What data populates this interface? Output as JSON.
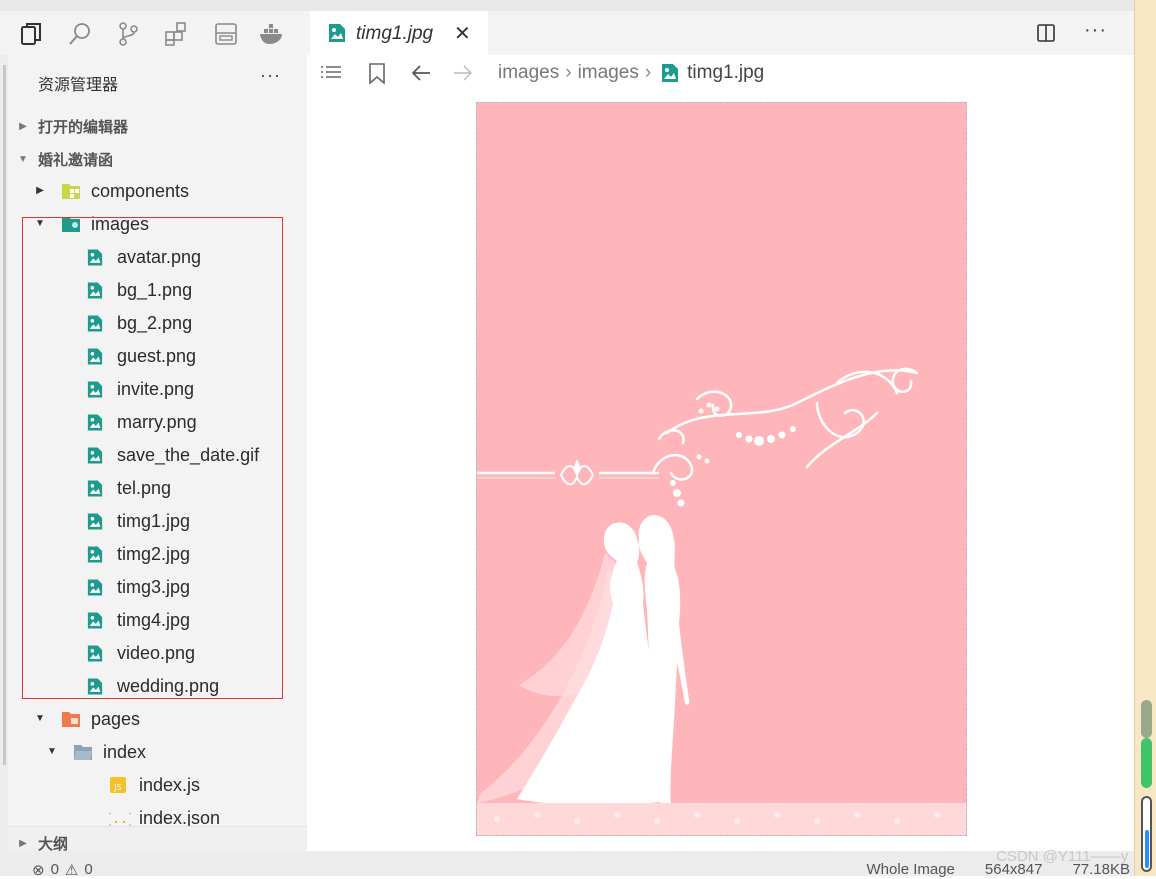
{
  "activity_bar": {
    "icons": [
      "explorer-icon",
      "search-icon",
      "source-control-icon",
      "extensions-icon",
      "panel-icon",
      "docker-icon"
    ]
  },
  "sidebar": {
    "title": "资源管理器",
    "more": "···",
    "open_editors": "打开的编辑器",
    "project": "婚礼邀请函",
    "tree": [
      {
        "label": "components",
        "kind": "folder-components",
        "depth": 0,
        "expanded": false
      },
      {
        "label": "images",
        "kind": "folder-images",
        "depth": 0,
        "expanded": true
      },
      {
        "label": "avatar.png",
        "kind": "image",
        "depth": 1
      },
      {
        "label": "bg_1.png",
        "kind": "image",
        "depth": 1
      },
      {
        "label": "bg_2.png",
        "kind": "image",
        "depth": 1
      },
      {
        "label": "guest.png",
        "kind": "image",
        "depth": 1
      },
      {
        "label": "invite.png",
        "kind": "image",
        "depth": 1
      },
      {
        "label": "marry.png",
        "kind": "image",
        "depth": 1
      },
      {
        "label": "save_the_date.gif",
        "kind": "image",
        "depth": 1
      },
      {
        "label": "tel.png",
        "kind": "image",
        "depth": 1
      },
      {
        "label": "timg1.jpg",
        "kind": "image",
        "depth": 1
      },
      {
        "label": "timg2.jpg",
        "kind": "image",
        "depth": 1
      },
      {
        "label": "timg3.jpg",
        "kind": "image",
        "depth": 1
      },
      {
        "label": "timg4.jpg",
        "kind": "image",
        "depth": 1
      },
      {
        "label": "video.png",
        "kind": "image",
        "depth": 1
      },
      {
        "label": "wedding.png",
        "kind": "image",
        "depth": 1
      },
      {
        "label": "pages",
        "kind": "folder-pages",
        "depth": 0,
        "expanded": true
      },
      {
        "label": "index",
        "kind": "folder",
        "depth": 1,
        "expanded": true
      },
      {
        "label": "index.js",
        "kind": "js",
        "depth": 2
      },
      {
        "label": "index.json",
        "kind": "json",
        "depth": 2
      }
    ],
    "outline": "大纲"
  },
  "editor": {
    "tab": {
      "label": "timg1.jpg",
      "close": "✕"
    },
    "more": "···",
    "breadcrumb": [
      "images",
      "images",
      "timg1.jpg"
    ],
    "breadcrumb_sep": "›"
  },
  "status": {
    "errors": "0",
    "warnings": "0",
    "view": "Whole Image",
    "dimensions": "564x847",
    "size": "77.18KB"
  },
  "watermark": "CSDN @Y111——y",
  "colors": {
    "accent": "#1e9b8c",
    "image_bg": "#ffb6bb",
    "highlight_box": "#e0362e"
  }
}
